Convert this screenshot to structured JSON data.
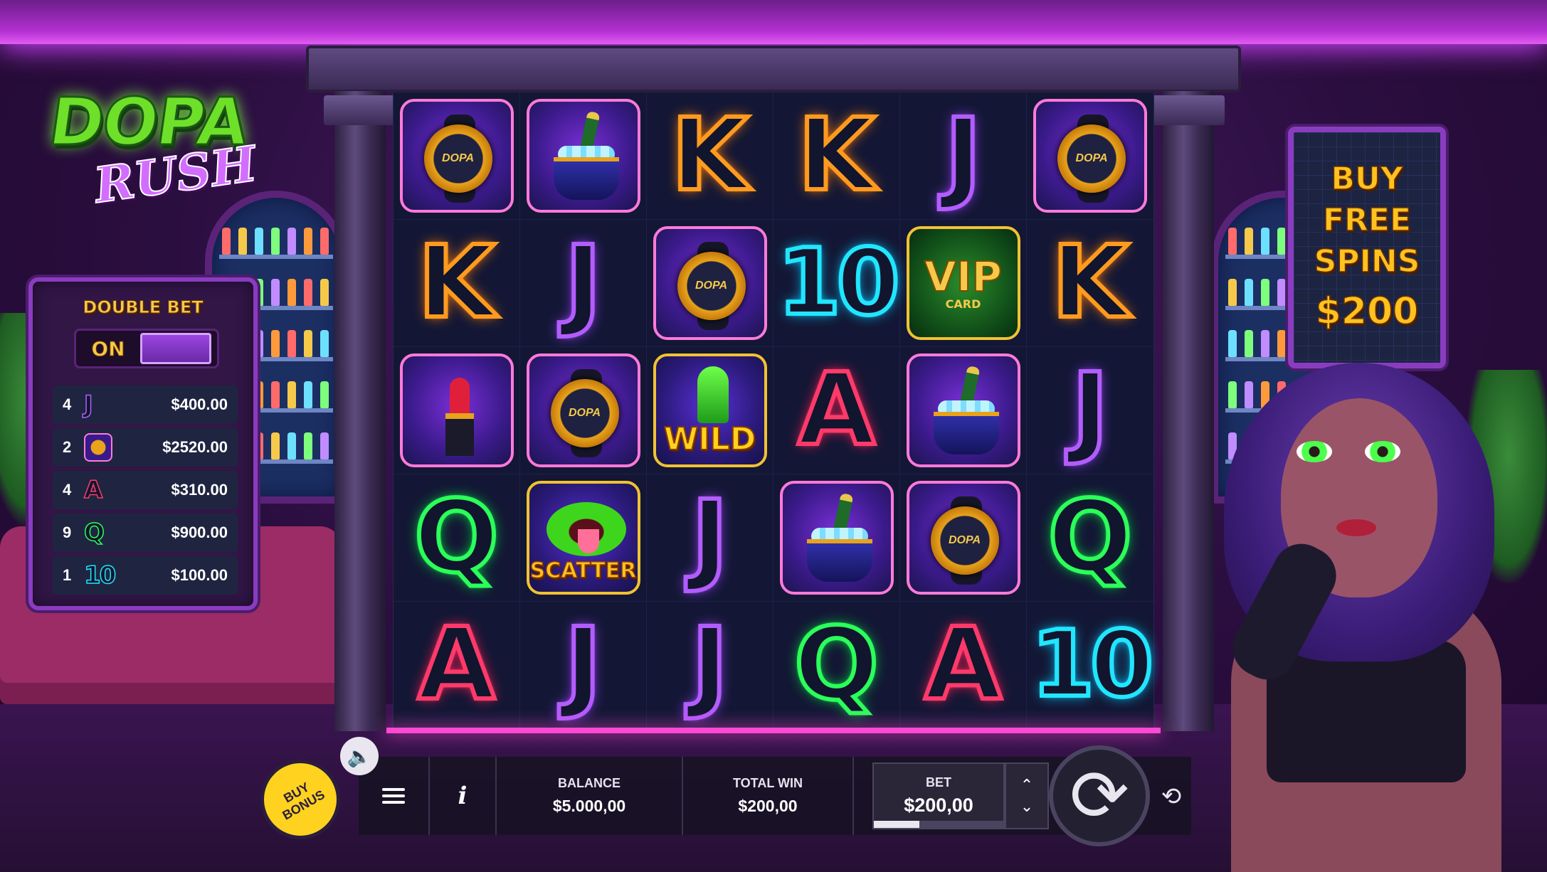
{
  "logo": {
    "main": "DOPA",
    "sub": "RUSH"
  },
  "double_bet": {
    "title": "DOUBLE BET",
    "toggle_label": "ON",
    "paylist": [
      {
        "count": "4",
        "symbol": "J",
        "symbol_type": "J",
        "amount": "$400.00"
      },
      {
        "count": "2",
        "symbol": "watch-icon",
        "symbol_type": "watch",
        "amount": "$2520.00"
      },
      {
        "count": "4",
        "symbol": "A",
        "symbol_type": "A",
        "amount": "$310.00"
      },
      {
        "count": "9",
        "symbol": "Q",
        "symbol_type": "Q",
        "amount": "$900.00"
      },
      {
        "count": "1",
        "symbol": "10",
        "symbol_type": "10",
        "amount": "$100.00"
      }
    ]
  },
  "buy_free_spins": {
    "line1": "BUY",
    "line2": "FREE",
    "line3": "SPINS",
    "price": "$200"
  },
  "reels": {
    "grid": [
      [
        "watch",
        "champagne",
        "K",
        "K",
        "J",
        "watch"
      ],
      [
        "K",
        "J",
        "watch",
        "10",
        "vip",
        "K"
      ],
      [
        "lipstick",
        "watch",
        "wild",
        "A",
        "champagne",
        "J"
      ],
      [
        "Q",
        "scatter",
        "J",
        "champagne",
        "watch",
        "Q"
      ],
      [
        "A",
        "J",
        "J",
        "Q",
        "A",
        "10"
      ]
    ],
    "wild_label": "WILD",
    "scatter_label": "SCATTER",
    "vip_label": "VIP",
    "vip_sub": "CARD",
    "watch_label": "DOPA"
  },
  "bottom_bar": {
    "buy_bonus": "BUY BONUS",
    "sound_icon": "speaker-icon",
    "menu_icon": "hamburger-menu-icon",
    "info_icon": "i",
    "balance_label": "BALANCE",
    "balance_value": "$5.000,00",
    "total_win_label": "TOTAL WIN",
    "total_win_value": "$200,00",
    "bet_label": "BET",
    "bet_value": "$200,00",
    "bet_level": 0.35,
    "up_icon": "⌃",
    "down_icon": "⌄",
    "spin_icon": "⟳",
    "autoplay_icon": "⟲"
  },
  "colors": {
    "accent_purple": "#8a3cc0",
    "neon_pink": "#ff49d4",
    "gold": "#ffc21f",
    "k_orange": "#ff9a1f",
    "j_purple": "#b35cff",
    "q_green": "#2bff5a",
    "a_red": "#ff3a6a",
    "ten_cyan": "#20e6ff"
  }
}
